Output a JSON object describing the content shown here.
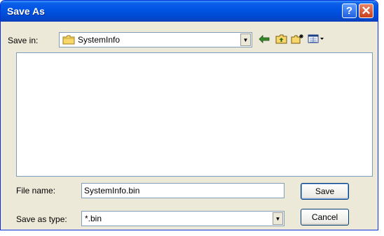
{
  "window": {
    "title": "Save As",
    "help_glyph": "?",
    "close_glyph": "✕"
  },
  "toolbar": {
    "save_in_label": "Save in:",
    "save_in_value": "SystemInfo",
    "icons": [
      "folder-icon",
      "back-arrow-icon",
      "up-folder-icon",
      "new-folder-icon",
      "view-menu-icon"
    ]
  },
  "file_list": {
    "items": []
  },
  "form": {
    "file_name_label": "File name:",
    "file_name_value": "SystemInfo.bin",
    "save_as_type_label": "Save as type:",
    "save_as_type_value": "*.bin"
  },
  "buttons": {
    "save": "Save",
    "cancel": "Cancel"
  },
  "colors": {
    "titlebar": "#0054e3",
    "dialog_bg": "#ece9d8",
    "close_button": "#c8401c"
  }
}
